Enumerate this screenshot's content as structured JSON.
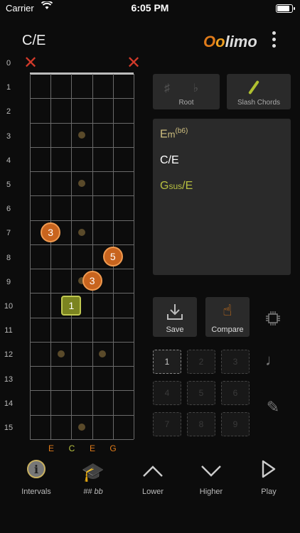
{
  "status": {
    "carrier": "Carrier",
    "time": "6:05 PM"
  },
  "header": {
    "chord": "C/E",
    "logo_a": "O",
    "logo_b": "o",
    "logo_c": "limo"
  },
  "fretboard": {
    "fret_numbers": [
      "0",
      "1",
      "2",
      "3",
      "4",
      "5",
      "6",
      "7",
      "8",
      "9",
      "10",
      "11",
      "12",
      "13",
      "14",
      "15"
    ],
    "muted_strings": [
      "1",
      "6"
    ],
    "notes": [
      {
        "label": "3",
        "fret": 7,
        "string": 2
      },
      {
        "label": "5",
        "fret": 8,
        "string": 5
      },
      {
        "label": "3",
        "fret": 9,
        "string": 4
      },
      {
        "label": "1",
        "fret": 10,
        "string": 3
      }
    ],
    "string_names": [
      "E",
      "C",
      "E",
      "G"
    ]
  },
  "panel": {
    "root_label": "Root",
    "root_glyphs": "♯ ♭",
    "slash_label": "Slash Chords",
    "chords": [
      {
        "base": "E",
        "mid": "m",
        "sup": "(b6)",
        "color": "#d0c080"
      },
      {
        "base": "C/E",
        "mid": "",
        "sup": "",
        "color": "#ffffff"
      },
      {
        "base": "G",
        "mid": "sus",
        "sup": "/E",
        "color": "#b8c040"
      }
    ],
    "save_label": "Save",
    "compare_label": "Compare",
    "slots": [
      "1",
      "2",
      "3",
      "4",
      "5",
      "6",
      "7",
      "8",
      "9"
    ]
  },
  "bottom": {
    "tabs": [
      {
        "label": "Intervals"
      },
      {
        "label": "## bb"
      },
      {
        "label": "Lower"
      },
      {
        "label": "Higher"
      },
      {
        "label": "Play"
      }
    ]
  },
  "colors": {
    "accent": "#e07b1a",
    "root": "#b8c040",
    "mute": "#d23a2a"
  }
}
